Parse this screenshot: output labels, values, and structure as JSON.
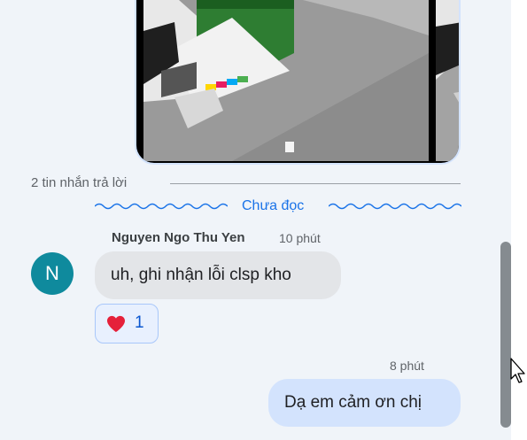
{
  "thread": {
    "images": [
      {
        "name": "attachment-image-1"
      },
      {
        "name": "attachment-image-2"
      }
    ],
    "reply_count_label": "2 tin nhắn trả lời",
    "unread_label": "Chưa đọc"
  },
  "messages": [
    {
      "sender": "Nguyen Ngo Thu Yen",
      "avatar_initial": "N",
      "avatar_color": "#0f8a9d",
      "time": "10 phút",
      "text": "uh, ghi nhận lỗi clsp kho",
      "reaction": {
        "emoji": "heart-icon",
        "count": "1"
      }
    },
    {
      "sender": "me",
      "time": "8 phút",
      "text": "Dạ em cảm ơn chị"
    }
  ],
  "colors": {
    "pane_bg": "#f0f4f9",
    "accent": "#1a73e8",
    "outgoing_bubble": "#d3e3fd",
    "incoming_bubble": "#e3e5e8",
    "heart": "#e5203a"
  }
}
